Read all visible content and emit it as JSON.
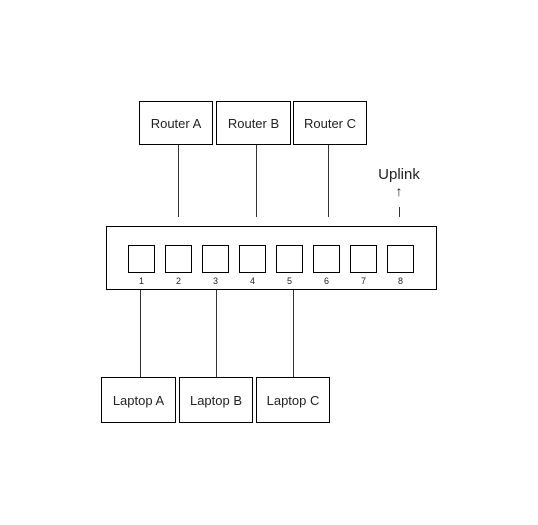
{
  "routers": [
    {
      "label": "Router A",
      "port": 2
    },
    {
      "label": "Router B",
      "port": 4
    },
    {
      "label": "Router C",
      "port": 6
    }
  ],
  "laptops": [
    {
      "label": "Laptop A",
      "port": 1
    },
    {
      "label": "Laptop B",
      "port": 3
    },
    {
      "label": "Laptop C",
      "port": 5
    }
  ],
  "switch": {
    "ports": [
      "1",
      "2",
      "3",
      "4",
      "5",
      "6",
      "7",
      "8"
    ]
  },
  "uplink": {
    "label": "Uplink",
    "port": 8,
    "arrow": "↑"
  }
}
